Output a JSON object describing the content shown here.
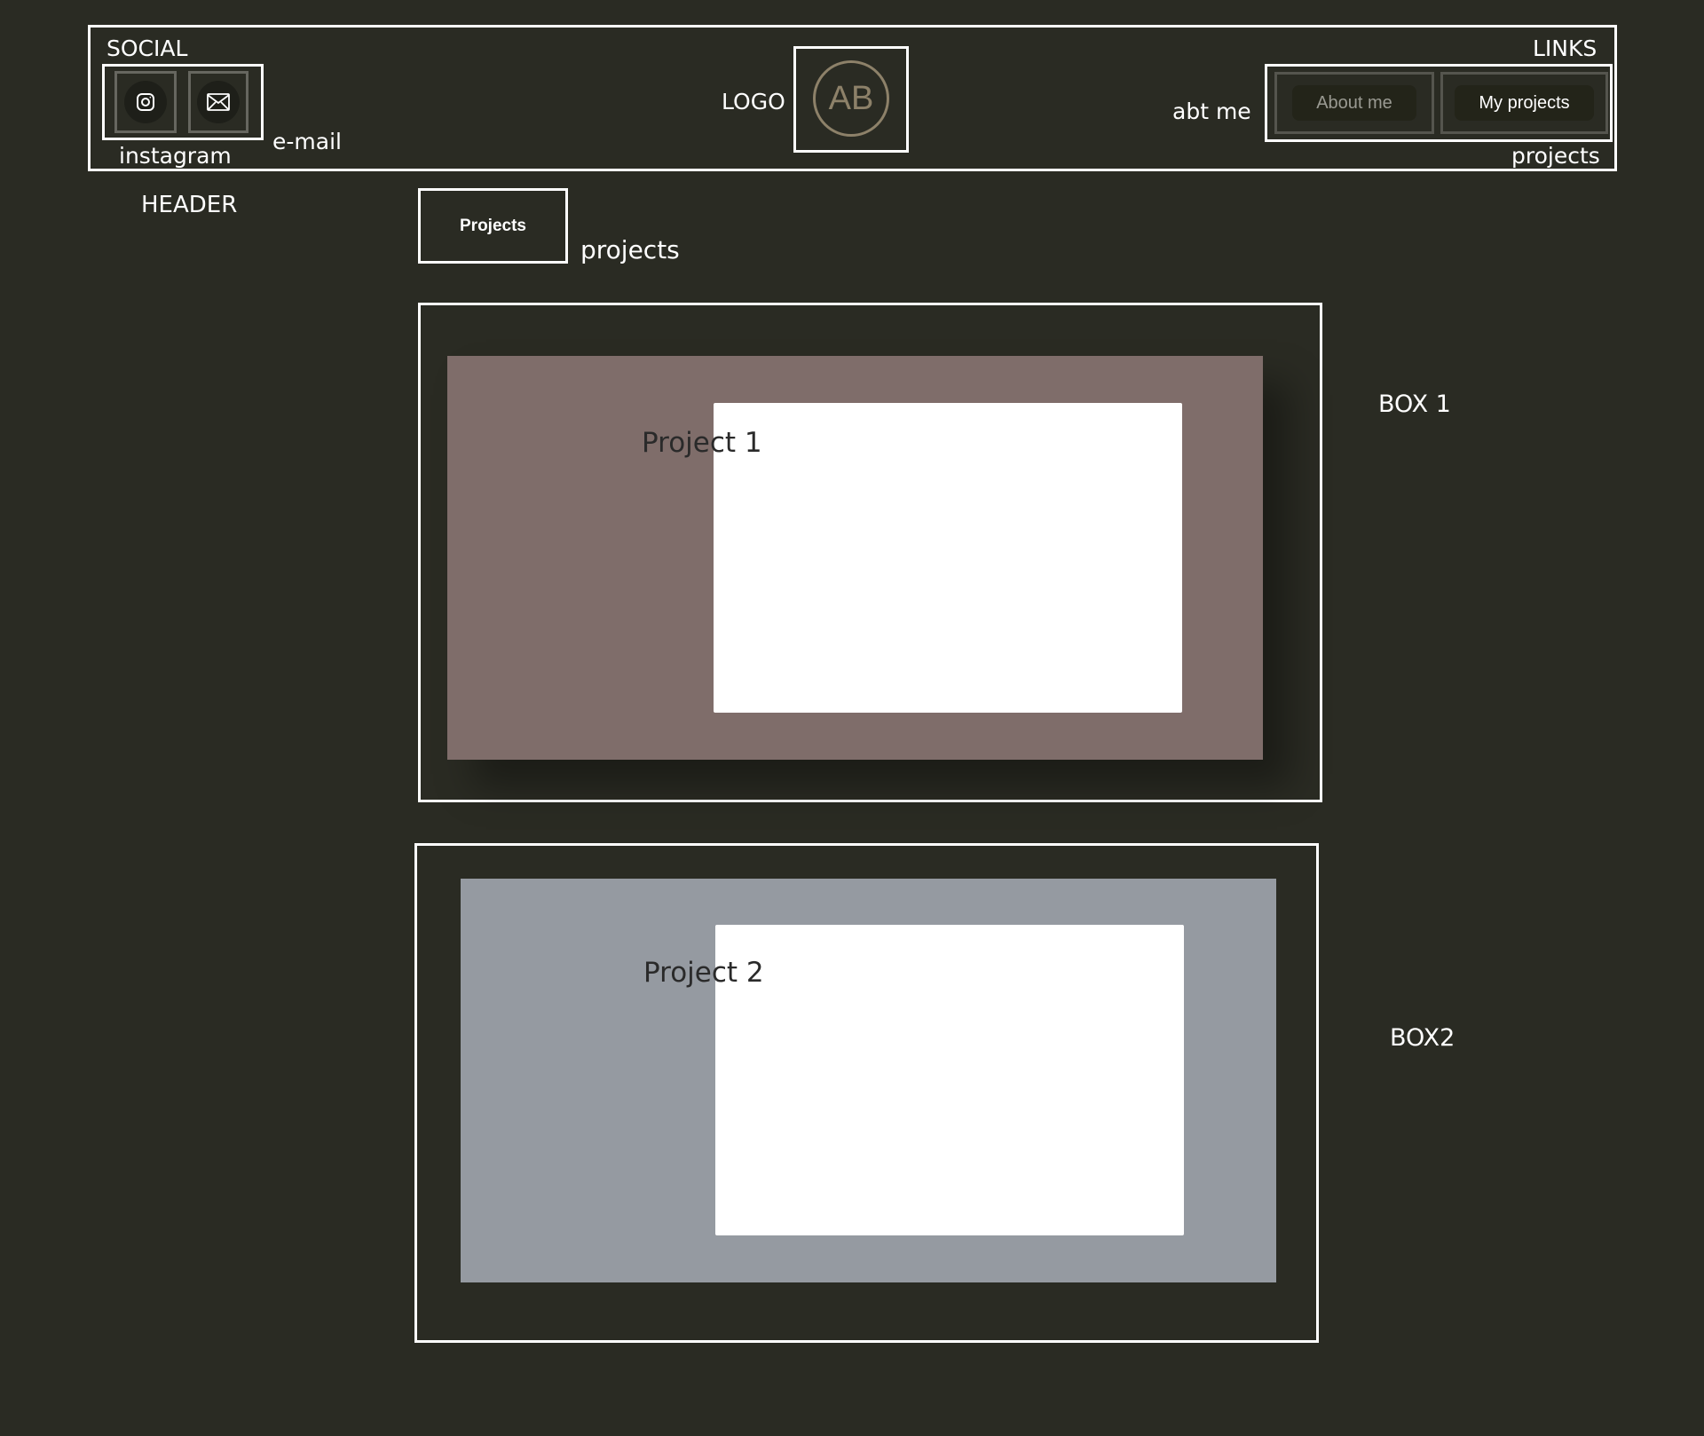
{
  "header": {
    "social_label": "SOCIAL",
    "links_label": "LINKS",
    "instagram_label": "instagram",
    "email_label": "e-mail",
    "logo_label": "LOGO",
    "logo_text": "AB",
    "abt_me_label": "abt me",
    "projects_label": "projects",
    "section_label": "HEADER",
    "nav": {
      "about": "About me",
      "projects": "My projects"
    },
    "icons": [
      "instagram-icon",
      "mail-icon"
    ]
  },
  "projects_section": {
    "button_label": "Projects",
    "annotation": "projects"
  },
  "boxes": [
    {
      "title": "Project 1",
      "annotation": "BOX 1",
      "color": "#7f6d6a"
    },
    {
      "title": "Project 2",
      "annotation": "BOX2",
      "color": "#959aa1"
    }
  ],
  "colors": {
    "background": "#2a2b23",
    "outline": "#ffffff",
    "logo_accent": "#8d8169",
    "nav_inactive_text": "#9a9a92"
  }
}
